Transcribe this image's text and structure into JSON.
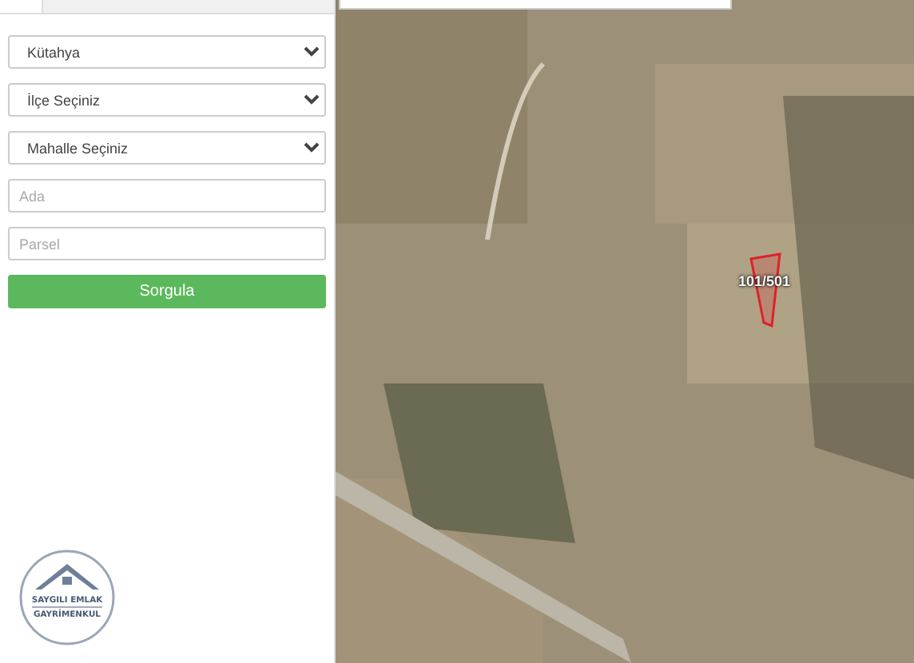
{
  "query_form": {
    "selects": [
      {
        "value": "Kütahya"
      },
      {
        "value": "İlçe Seçiniz"
      },
      {
        "value": "Mahalle Seçiniz"
      }
    ],
    "inputs": [
      {
        "placeholder": "Ada"
      },
      {
        "placeholder": "Parsel"
      }
    ],
    "submit": "Sorgula"
  },
  "logo": {
    "line_1": "SAYGILI EMLAK",
    "line_2": "GAYRİMENKUL"
  },
  "map": {
    "parcel_label": "101/501"
  }
}
